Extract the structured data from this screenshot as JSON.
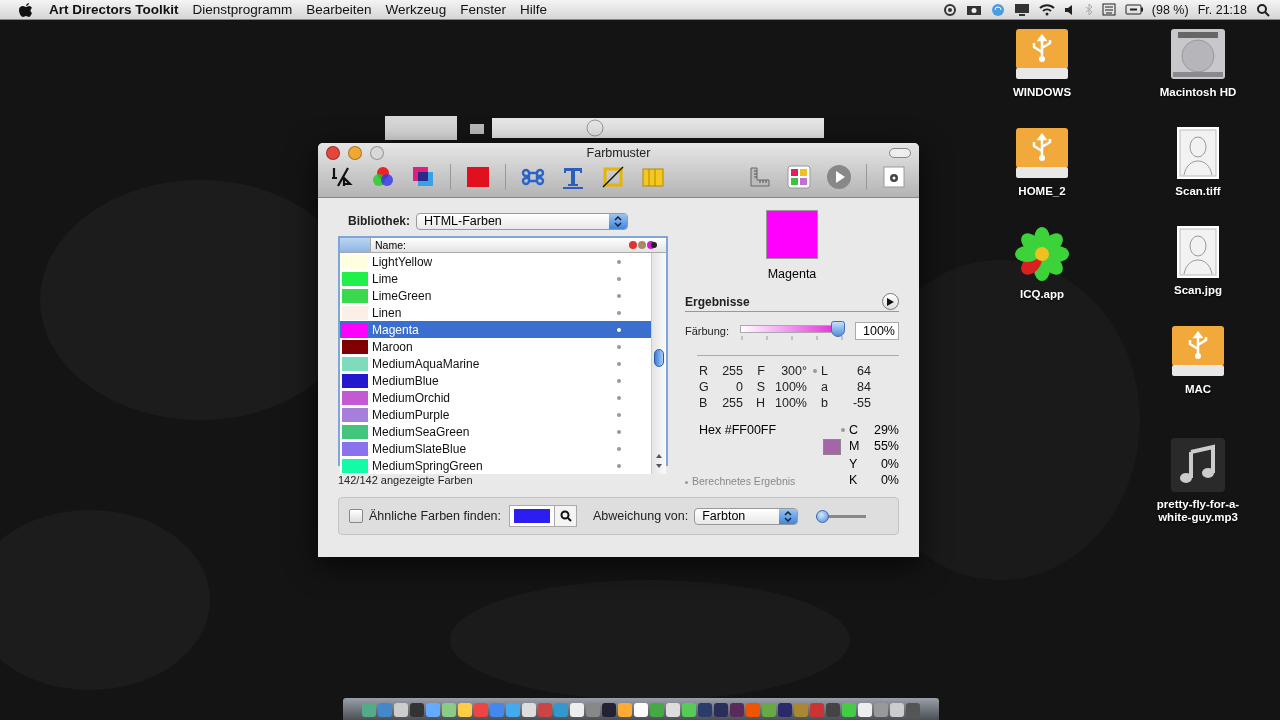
{
  "menu_bar": {
    "app_name": "Art Directors Toolkit",
    "menus": [
      "Dienstprogramm",
      "Bearbeiten",
      "Werkzeug",
      "Fenster",
      "Hilfe"
    ],
    "battery": "(98 %)",
    "clock": "Fr. 21:18"
  },
  "window": {
    "title": "Farbmuster",
    "library": {
      "label": "Bibliothek:",
      "value": "HTML-Farben"
    },
    "list": {
      "header": "Name:",
      "rows": [
        {
          "name": "LightYellow",
          "color": "#ffffe0",
          "selected": false
        },
        {
          "name": "Lime",
          "color": "#22f04a",
          "selected": false
        },
        {
          "name": "LimeGreen",
          "color": "#3ad84c",
          "selected": false
        },
        {
          "name": "Linen",
          "color": "#faf0e6",
          "selected": false
        },
        {
          "name": "Magenta",
          "color": "#ff00ff",
          "selected": true
        },
        {
          "name": "Maroon",
          "color": "#800000",
          "selected": false
        },
        {
          "name": "MediumAquaMarine",
          "color": "#7edcbc",
          "selected": false
        },
        {
          "name": "MediumBlue",
          "color": "#2418cd",
          "selected": false
        },
        {
          "name": "MediumOrchid",
          "color": "#c45ad3",
          "selected": false
        },
        {
          "name": "MediumPurple",
          "color": "#a57fdb",
          "selected": false
        },
        {
          "name": "MediumSeaGreen",
          "color": "#44c57e",
          "selected": false
        },
        {
          "name": "MediumSlateBlue",
          "color": "#8a72ee",
          "selected": false
        },
        {
          "name": "MediumSpringGreen",
          "color": "#13fba6",
          "selected": false
        }
      ],
      "count": "142/142 angezeigte Farben"
    },
    "preview": {
      "name": "Magenta",
      "color": "#ff00ff"
    },
    "results": {
      "title": "Ergebnisse",
      "tint": {
        "label": "Färbung:",
        "level": 0.93,
        "reading": "100%"
      },
      "rows": [
        [
          {
            "label": "R",
            "value": "255"
          },
          {
            "label": "F",
            "value": "300°"
          },
          {
            "label": "L",
            "value": "64"
          }
        ],
        [
          {
            "label": "G",
            "value": "0"
          },
          {
            "label": "S",
            "value": "100%"
          },
          {
            "label": "a",
            "value": "84"
          }
        ],
        [
          {
            "label": "B",
            "value": "255"
          },
          {
            "label": "H",
            "value": "100%"
          },
          {
            "label": "b",
            "value": "-55"
          }
        ]
      ],
      "hex": {
        "label": "Hex",
        "value": "#FF00FF"
      },
      "cmyk": [
        {
          "label": "C",
          "value": "29%"
        },
        {
          "label": "M",
          "value": "55%"
        },
        {
          "label": "Y",
          "value": "0%"
        },
        {
          "label": "K",
          "value": "0%"
        }
      ],
      "swatch": {
        "color": "#a565a8"
      },
      "note": "Berechnetes Ergebnis"
    },
    "similar": {
      "checked": false,
      "label": "Ähnliche Farben finden:",
      "color": "#2a1ff0"
    },
    "deviation": {
      "label": "Abweichung von:",
      "value": "Farbton",
      "level": 0
    }
  },
  "desktop_icons": [
    {
      "label": "WINDOWS",
      "kind": "usb"
    },
    {
      "label": "Macintosh HD",
      "kind": "disk"
    },
    {
      "label": "HOME_2",
      "kind": "usb"
    },
    {
      "label": "Scan.tiff",
      "kind": "scan"
    },
    {
      "label": "ICQ.app",
      "kind": "flower"
    },
    {
      "label": "Scan.jpg",
      "kind": "scan"
    },
    {
      "label": "MAC",
      "kind": "usb"
    },
    {
      "label": "pretty-fly-for-a-white-guy.mp3",
      "kind": "music"
    }
  ]
}
